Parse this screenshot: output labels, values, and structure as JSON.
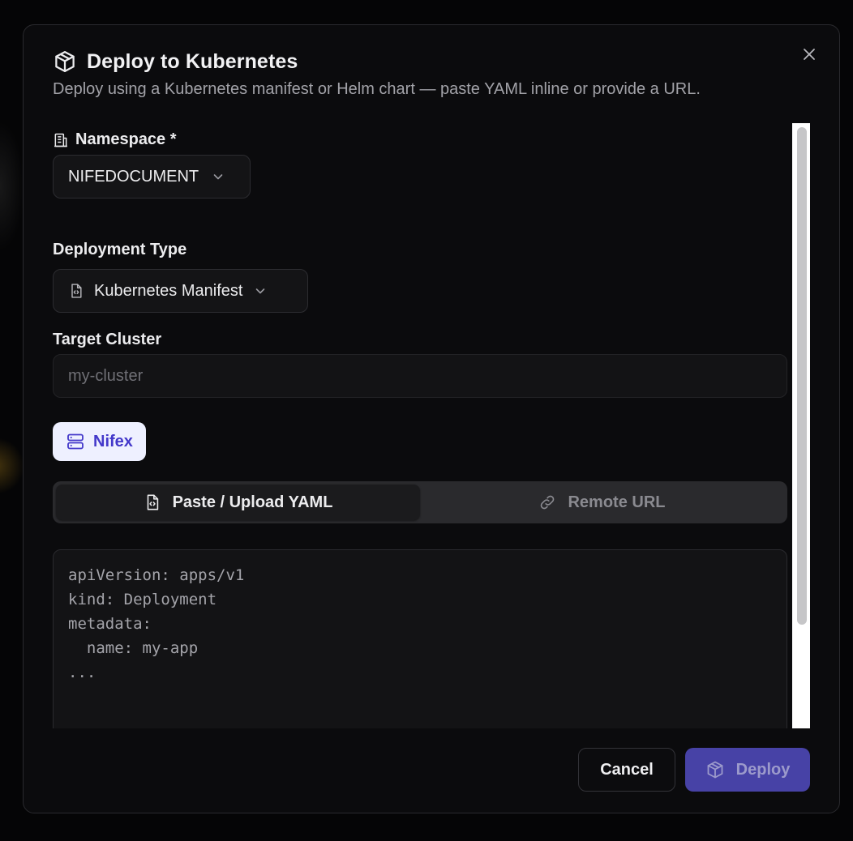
{
  "dialog": {
    "title": "Deploy to Kubernetes",
    "subtitle": "Deploy using a Kubernetes manifest or Helm chart — paste YAML inline or provide a URL.",
    "title_icon": "package-icon",
    "close_icon": "close-icon"
  },
  "namespace": {
    "label": "Namespace *",
    "icon": "building-icon",
    "value": "NIFEDOCUMENT"
  },
  "deployment_type": {
    "label": "Deployment Type",
    "value": "Kubernetes Manifest",
    "icon": "file-code-icon"
  },
  "target_cluster": {
    "label": "Target Cluster",
    "placeholder": "my-cluster",
    "value": ""
  },
  "nifex_chip": {
    "label": "Nifex",
    "icon": "server-icon"
  },
  "source_tabs": [
    {
      "label": "Paste / Upload YAML",
      "icon": "file-code-icon",
      "active": true
    },
    {
      "label": "Remote URL",
      "icon": "link-icon",
      "active": false
    }
  ],
  "yaml_editor": {
    "placeholder": "apiVersion: apps/v1\nkind: Deployment\nmetadata:\n  name: my-app\n..."
  },
  "footer": {
    "cancel_label": "Cancel",
    "deploy_label": "Deploy"
  },
  "colors": {
    "accent": "#4742a6",
    "chip_bg": "#eef0ff",
    "chip_text": "#4338ca",
    "dialog_bg": "#0b0b0d"
  }
}
